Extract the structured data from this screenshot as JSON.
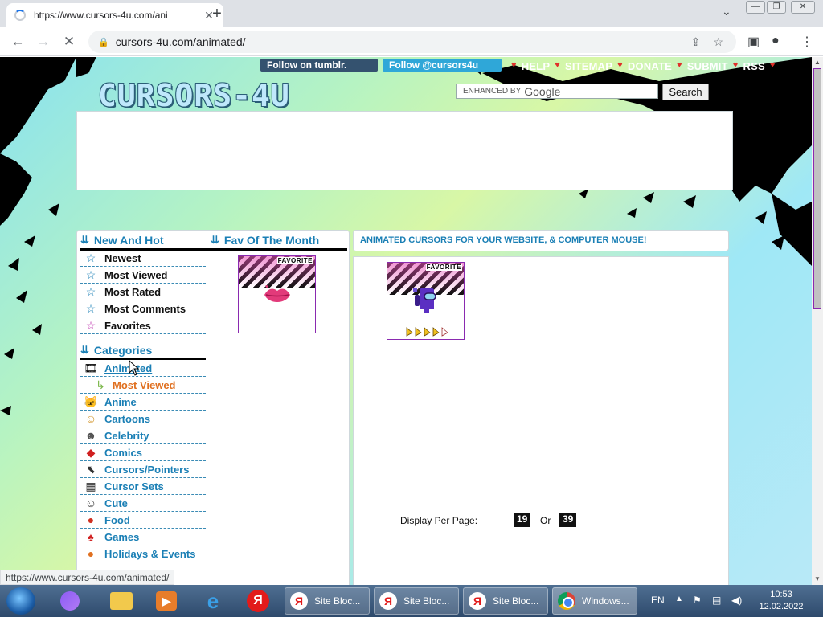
{
  "browser": {
    "tab_title": "https://www.cursors-4u.com/ani",
    "tab_close": "✕",
    "new_tab": "+",
    "url": "cursors-4u.com/animated/",
    "status_url": "https://www.cursors-4u.com/animated/"
  },
  "header": {
    "tumblr": "Follow on tumblr.",
    "twitter": "Follow @cursors4u",
    "nav": [
      "HELP",
      "SITEMAP",
      "DONATE",
      "SUBMIT",
      "RSS"
    ],
    "logo": "CURSORS-4U",
    "search_placeholder": "ENHANCED BY",
    "search_brand": "Google",
    "search_button": "Search"
  },
  "sidebar": {
    "new_and_hot_title": "New And Hot",
    "fav_title": "Fav Of The Month",
    "fav_badge": "FAVORITE",
    "menu": [
      {
        "label": "Newest",
        "icon": "star-icon"
      },
      {
        "label": "Most Viewed",
        "icon": "star-icon"
      },
      {
        "label": "Most Rated",
        "icon": "star-icon"
      },
      {
        "label": "Most Comments",
        "icon": "star-icon"
      },
      {
        "label": "Favorites",
        "icon": "star-pink-icon"
      }
    ],
    "categories_title": "Categories",
    "categories": [
      {
        "label": "Animated",
        "icon": "film-icon"
      },
      {
        "label": "Most Viewed",
        "icon": "arrow-sub-icon",
        "sub": true
      },
      {
        "label": "Anime",
        "icon": "hello-kitty-icon"
      },
      {
        "label": "Cartoons",
        "icon": "cartoon-icon"
      },
      {
        "label": "Celebrity",
        "icon": "celebrity-icon"
      },
      {
        "label": "Comics",
        "icon": "superman-icon"
      },
      {
        "label": "Cursors/Pointers",
        "icon": "pointer-icon"
      },
      {
        "label": "Cursor Sets",
        "icon": "cursor-set-icon"
      },
      {
        "label": "Cute",
        "icon": "smiley-icon"
      },
      {
        "label": "Food",
        "icon": "apple-icon"
      },
      {
        "label": "Games",
        "icon": "mario-icon"
      },
      {
        "label": "Holidays & Events",
        "icon": "pumpkin-icon"
      }
    ]
  },
  "main": {
    "heading": "ANIMATED CURSORS FOR YOUR WEBSITE, & COMPUTER MOUSE!",
    "item_badge": "FAVORITE",
    "display_per_page": "Display Per Page:",
    "pp_a": "19",
    "or": "Or",
    "pp_b": "39"
  },
  "taskbar": {
    "tasks": [
      "Site Bloc...",
      "Site Bloc...",
      "Site Bloc...",
      "Windows..."
    ],
    "lang": "EN",
    "time": "10:53",
    "date": "12.02.2022",
    "yandex_letter": "Я"
  },
  "colors": {
    "accent": "#1a7fb5",
    "link_orange": "#e07020"
  }
}
